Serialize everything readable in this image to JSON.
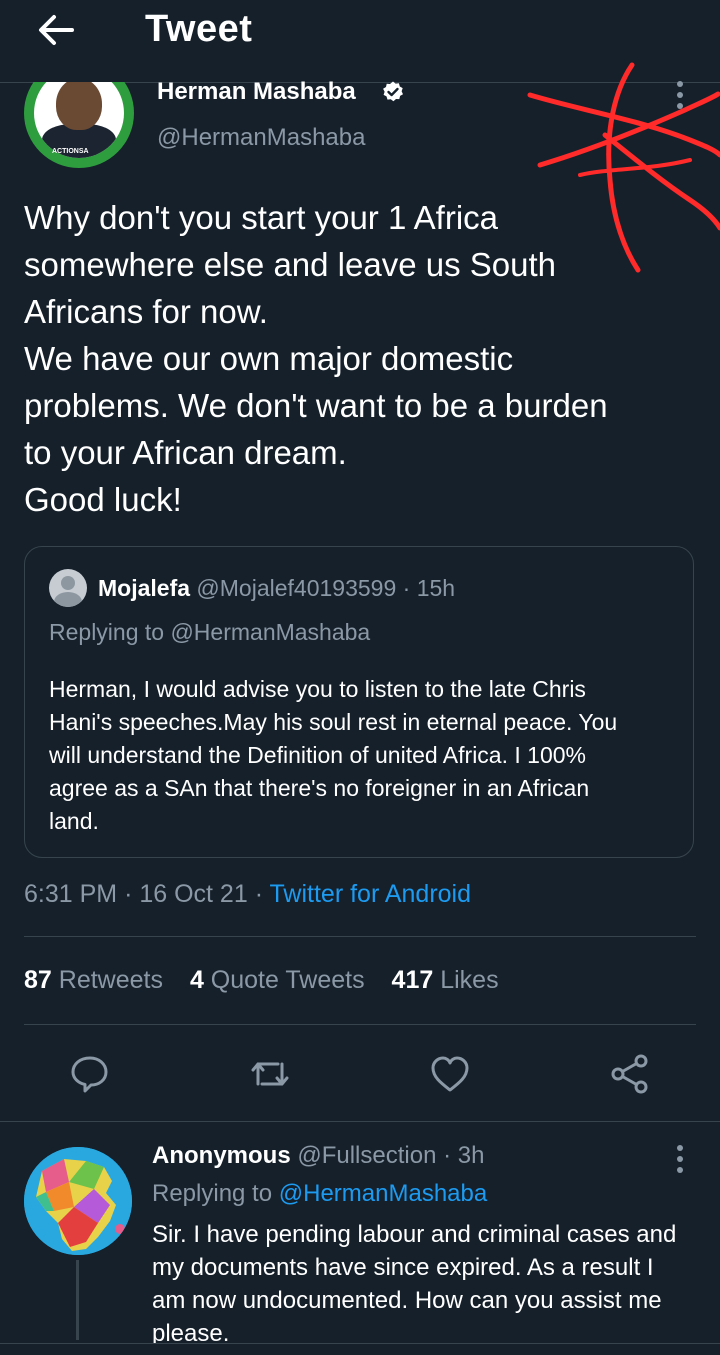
{
  "header": {
    "title": "Tweet"
  },
  "tweet": {
    "author_name": "Herman Mashaba",
    "author_handle": "@HermanMashaba",
    "avatar_text": "ACTIONSA",
    "text_lines": [
      "Why don't you start your 1 Africa",
      "somewhere else and leave us South",
      "Africans for now.",
      "We have our own major domestic",
      "problems. We don't want to be a burden",
      "to your African dream.",
      "Good luck!"
    ],
    "time": "6:31 PM",
    "date": "16 Oct 21",
    "source": "Twitter for Android",
    "retweets": "87",
    "retweets_label": "Retweets",
    "quote_tweets": "4",
    "quote_tweets_label": "Quote Tweets",
    "likes": "417",
    "likes_label": "Likes"
  },
  "quote": {
    "name": "Mojalefa",
    "handle": "@Mojalef40193599",
    "time": "15h",
    "replying_to": "Replying to @HermanMashaba",
    "text_lines": [
      "Herman, I would advise you to listen to the late Chris",
      "Hani's speeches.May his soul rest in eternal peace. You",
      "will understand the Definition of united Africa. I 100%",
      "agree as a SAn that there's no foreigner in an African",
      "land."
    ]
  },
  "reply": {
    "name": "Anonymous",
    "handle": "@Fullsection",
    "time": "3h",
    "replying_prefix": "Replying to",
    "replying_handle": "@HermanMashaba",
    "text_lines": [
      "Sir. I have pending labour and criminal cases and",
      "my documents have since expired. As a result I",
      "am now undocumented. How can you assist me",
      "please."
    ]
  },
  "colors": {
    "background": "#15202b",
    "accent": "#1d9bf0",
    "muted": "#8b98a5",
    "divider": "#38444d",
    "annotation": "#ff2a2a"
  },
  "icons": {
    "back": "arrow-left-icon",
    "verified": "verified-badge-icon",
    "more": "more-vertical-icon",
    "reply": "reply-icon",
    "retweet": "retweet-icon",
    "like": "heart-icon",
    "share": "share-icon"
  }
}
